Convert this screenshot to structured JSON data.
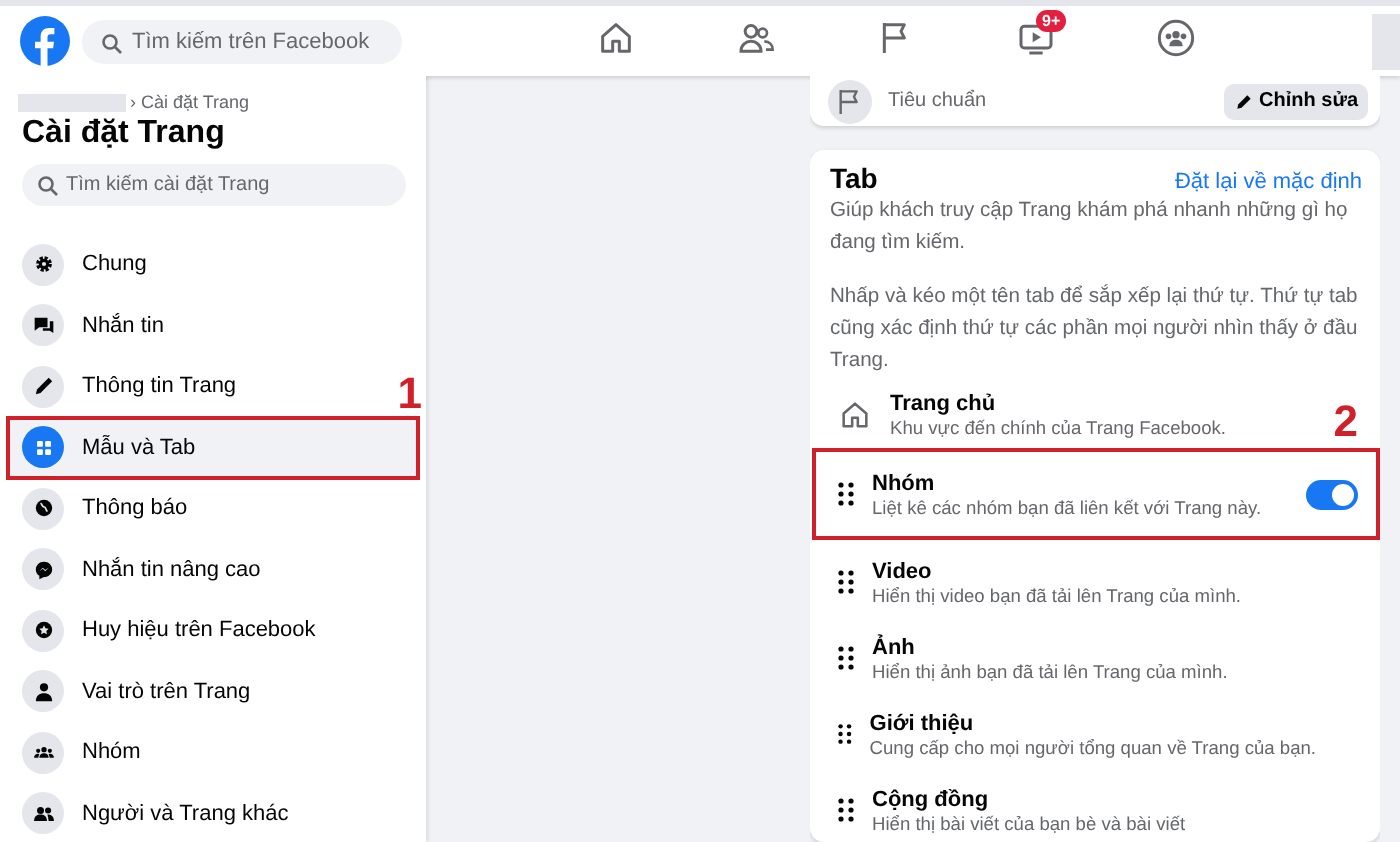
{
  "topbar": {
    "search": {
      "placeholder": "Tìm kiếm trên Facebook"
    },
    "nav": [
      {
        "kind": "home",
        "selected": false
      },
      {
        "kind": "friends",
        "selected": false
      },
      {
        "kind": "flag",
        "selected": false
      },
      {
        "kind": "video",
        "selected": false,
        "badge": "9+"
      },
      {
        "kind": "groups",
        "selected": false
      }
    ]
  },
  "sidebar": {
    "breadcrumb": "› Cài đặt Trang",
    "title": "Cài đặt Trang",
    "search": {
      "placeholder": "Tìm kiếm cài đặt Trang"
    },
    "items": [
      {
        "label": "Chung",
        "selected": false
      },
      {
        "label": "Nhắn tin",
        "selected": false
      },
      {
        "label": "Thông tin Trang",
        "selected": false
      },
      {
        "label": "Mẫu và Tab",
        "selected": true,
        "callout": "1"
      },
      {
        "label": "Thông báo",
        "selected": false
      },
      {
        "label": "Nhắn tin nâng cao",
        "selected": false
      },
      {
        "label": "Huy hiệu trên Facebook",
        "selected": false
      },
      {
        "label": "Vai trò trên Trang",
        "selected": false
      },
      {
        "label": "Nhóm",
        "selected": false
      },
      {
        "label": "Người và Trang khác",
        "selected": false
      }
    ]
  },
  "template_card": {
    "subtitle": "Tiêu chuẩn",
    "edit_button": "Chỉnh sửa"
  },
  "tabs_card": {
    "title": "Tab",
    "reset_link": "Đặt lại về mặc định",
    "descriptions": [
      "Giúp khách truy cập Trang khám phá nhanh những gì họ đang tìm kiếm.",
      "Nhấp và kéo một tên tab để sắp xếp lại thứ tự. Thứ tự tab cũng xác định thứ tự các phần mọi người nhìn thấy ở đầu Trang."
    ],
    "tabs": [
      {
        "kind": "fixed",
        "name": "Trang chủ",
        "description": "Khu vực đến chính của Trang Facebook."
      },
      {
        "kind": "draggable",
        "name": "Nhóm",
        "description": "Liệt kê các nhóm bạn đã liên kết với Trang này.",
        "on": true,
        "callout": "2"
      },
      {
        "kind": "draggable",
        "name": "Video",
        "description": "Hiển thị video bạn đã tải lên Trang của mình."
      },
      {
        "kind": "draggable",
        "name": "Ảnh",
        "description": "Hiển thị ảnh bạn đã tải lên Trang của mình."
      },
      {
        "kind": "draggable",
        "name": "Giới thiệu",
        "description": "Cung cấp cho mọi người tổng quan về Trang của bạn."
      },
      {
        "kind": "draggable",
        "name": "Cộng đồng",
        "description": "Hiển thị bài viết của bạn bè và bài viết"
      }
    ]
  }
}
